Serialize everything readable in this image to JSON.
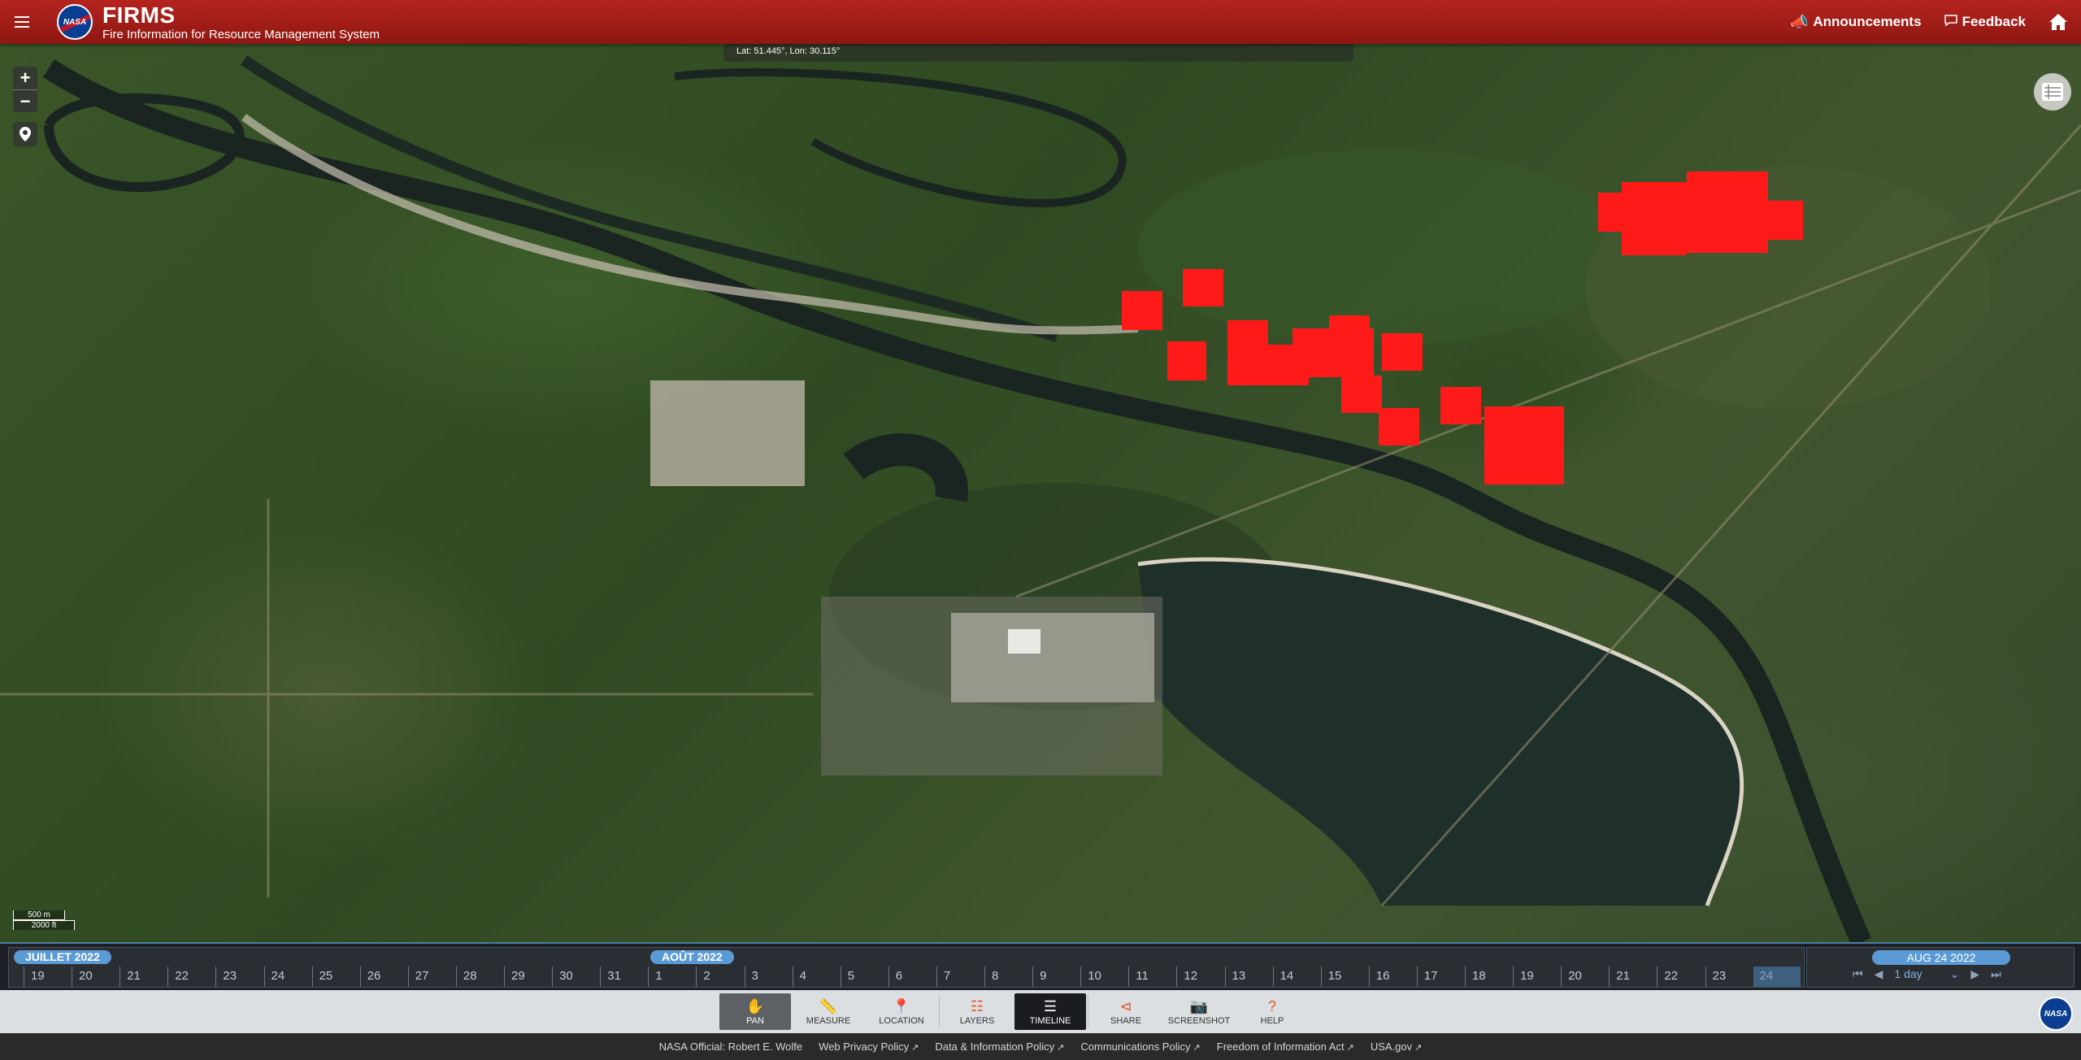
{
  "header": {
    "title": "FIRMS",
    "subtitle": "Fire Information for Resource Management System",
    "logo_text": "NASA",
    "announcements_label": "Announcements",
    "feedback_label": "Feedback"
  },
  "map": {
    "coord_readout": "Lat: 51.445°, Lon: 30.115°",
    "zoom_in": "+",
    "zoom_out": "−",
    "scale_metric": "500 m",
    "scale_imperial": "2000 ft",
    "fire_color": "#ff1a1a"
  },
  "timeline": {
    "month1": "JUILLET 2022",
    "month2": "AOÛT 2022",
    "days_july": [
      "19",
      "20",
      "21",
      "22",
      "23",
      "24",
      "25",
      "26",
      "27",
      "28",
      "29",
      "30",
      "31"
    ],
    "days_august": [
      "1",
      "2",
      "3",
      "4",
      "5",
      "6",
      "7",
      "8",
      "9",
      "10",
      "11",
      "12",
      "13",
      "14",
      "15",
      "16",
      "17",
      "18",
      "19",
      "20",
      "21",
      "22",
      "23",
      "24"
    ],
    "current_date": "AUG 24 2022",
    "interval": "1 day"
  },
  "toolbar": {
    "pan": "PAN",
    "measure": "MEASURE",
    "location": "LOCATION",
    "layers": "LAYERS",
    "timeline": "TIMELINE",
    "share": "SHARE",
    "screenshot": "SCREENSHOT",
    "help": "HELP"
  },
  "footer": {
    "official": "NASA Official: Robert E. Wolfe",
    "links": [
      "Web Privacy Policy",
      "Data & Information Policy",
      "Communications Policy",
      "Freedom of Information Act",
      "USA.gov"
    ]
  }
}
